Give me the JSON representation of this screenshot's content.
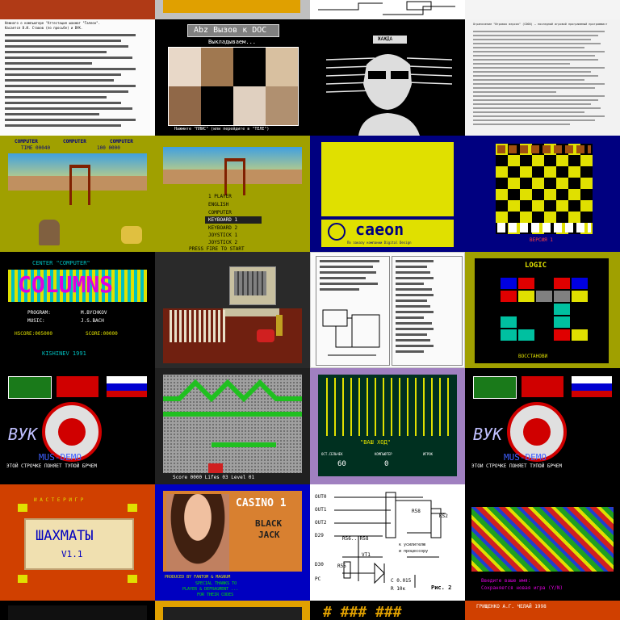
{
  "tiles": {
    "r1c0": {
      "caption": "Немного о компьютере \"Аттестация шахмат \"Галеон\".",
      "subcaption": "Касается В.И. Ставов (по просьбе) и ВУК."
    },
    "r1c1": {
      "title": "Abz Вызов к DOC",
      "subtitle": "Выкладываем...",
      "footer": "Нажмите \"ПЛИС\" (или перейдите в \"ТЕЛЕ\")"
    },
    "r1c2": {
      "label": "ЖАЖДА"
    },
    "r1c3": {
      "caption": "Ограничение \"Игровая версия\" (C000) — последний игровой программный программист"
    },
    "r2c0": {
      "header_left": "COMPUTER",
      "header_mid": "COMPUTER",
      "header_right": "COMPUTER",
      "score_left": "TIME 00040",
      "score_right": "100 0000"
    },
    "r2c1": {
      "menu": [
        "1 PLAYER",
        "ENGLISH",
        "COMPUTER",
        "KEYBOARD 1",
        "KEYBOARD 2",
        "JOYSTICK 1",
        "JOYSTICK 2",
        "PRESS FIRE TO START"
      ]
    },
    "r2c2": {
      "logo": "caeon",
      "footer": "По заказу компании Digital Design"
    },
    "r2c3": {
      "footer": "ВЕРСИЯ 1"
    },
    "r3c0": {
      "header": "CENTER \"COMPUTER\"",
      "title": "COLUMNS",
      "program_label": "PROGRAM:",
      "program_value": "M.BYCHKOV",
      "music_label": "MUSIC:",
      "music_value": "J.S.BACH",
      "hscore": "HSCORE:005000",
      "score": "SCORE:00000",
      "footer": "KISHINEV 1991"
    },
    "r3c3": {
      "title": "LOGIC",
      "footer": "ВОССТАНОВИ"
    },
    "r4c0": {
      "brand": "ВУК",
      "subtitle": "MUS-DEMO",
      "ticker": "ЭТОЙ СТРОЧКЕ ПОНЯЕТ ТУПОЙ БРЧЕМ"
    },
    "r4c1": {
      "status": "Score 0000 Lifes 03 Level 01"
    },
    "r4c2": {
      "center": "\"ВАШ ХОД\"",
      "label_left": "ОСТ.СЕЛЬЧЕК",
      "label_mid": "КОМПЬЮТЕР",
      "label_right": "ИГРОК",
      "score_left": "60",
      "score_right": "0"
    },
    "r4c3": {
      "brand": "ВУК",
      "subtitle": "MUS-DEMO",
      "ticker": "ЭТОИ СТРОЧКЕ ПОНЯЕТ ТУПОЙ БРЧЕМ"
    },
    "r5c0": {
      "header": "И А С Т Е Р  И Г Р",
      "title": "ШАХМАТЫ",
      "version": "V1.1"
    },
    "r5c1": {
      "title": "CASINO 1",
      "subtitle1": "BLACK",
      "subtitle2": "JACK",
      "credits1": "PRODUCED BY FANTOM & MAGNUM",
      "credits2": "SPECIAL THANKS TO",
      "credits3": "PLAYER & DEFRAGMENT ...",
      "credits4": "FOR THEIR CODES"
    },
    "r5c2": {
      "labels": [
        "OUT0",
        "OUT1",
        "OUT2",
        "D29",
        "R58",
        "R56...R58",
        "VT1",
        "R55",
        "KS2",
        "к усилителю",
        "и процессору",
        "C 0.015",
        "R 10к",
        "Рис. 2",
        "D30",
        "PC"
      ]
    },
    "r5c3": {
      "line1": "Введите ваше имя:",
      "line2": "Сохраняется новая игра (Y/N)"
    },
    "r6c2": {
      "text": "# ### ###"
    },
    "r6c3": {
      "text": "ГРИЩЕНКО А.Г.     ЧЕЛАЙ 1998"
    }
  },
  "colors": {
    "bg": "#ffffff",
    "olive": "#a0a000",
    "dark": "#000000",
    "navy": "#000080",
    "orange": "#d04000",
    "purple": "#a080c0",
    "yellow": "#e0e000",
    "cyan": "#00c0c0"
  }
}
